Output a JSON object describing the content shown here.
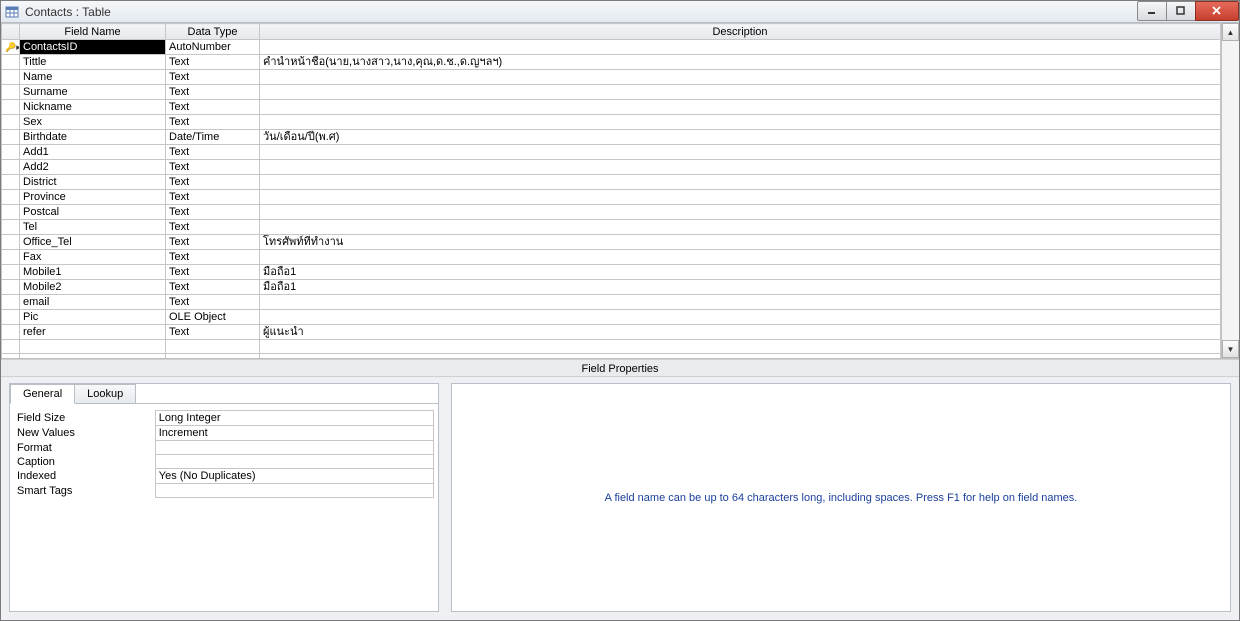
{
  "window": {
    "title": "Contacts : Table"
  },
  "grid": {
    "headers": {
      "field_name": "Field Name",
      "data_type": "Data Type",
      "description": "Description"
    },
    "rows": [
      {
        "pk": true,
        "field": "ContactsID",
        "type": "AutoNumber",
        "desc": ""
      },
      {
        "pk": false,
        "field": "Tittle",
        "type": "Text",
        "desc": "คำนำหน้าชื่อ(นาย,นางสาว,นาง,คุณ,ด.ช.,ด.ญฯลฯ)"
      },
      {
        "pk": false,
        "field": "Name",
        "type": "Text",
        "desc": ""
      },
      {
        "pk": false,
        "field": "Surname",
        "type": "Text",
        "desc": ""
      },
      {
        "pk": false,
        "field": "Nickname",
        "type": "Text",
        "desc": ""
      },
      {
        "pk": false,
        "field": "Sex",
        "type": "Text",
        "desc": ""
      },
      {
        "pk": false,
        "field": "Birthdate",
        "type": "Date/Time",
        "desc": "วัน/เดือน/ปี(พ.ศ)"
      },
      {
        "pk": false,
        "field": "Add1",
        "type": "Text",
        "desc": ""
      },
      {
        "pk": false,
        "field": "Add2",
        "type": "Text",
        "desc": ""
      },
      {
        "pk": false,
        "field": "District",
        "type": "Text",
        "desc": ""
      },
      {
        "pk": false,
        "field": "Province",
        "type": "Text",
        "desc": ""
      },
      {
        "pk": false,
        "field": "Postcal",
        "type": "Text",
        "desc": ""
      },
      {
        "pk": false,
        "field": "Tel",
        "type": "Text",
        "desc": ""
      },
      {
        "pk": false,
        "field": "Office_Tel",
        "type": "Text",
        "desc": "โทรศัพท์ที่ทำงาน"
      },
      {
        "pk": false,
        "field": "Fax",
        "type": "Text",
        "desc": ""
      },
      {
        "pk": false,
        "field": "Mobile1",
        "type": "Text",
        "desc": "มือถือ1"
      },
      {
        "pk": false,
        "field": "Mobile2",
        "type": "Text",
        "desc": "มือถือ1"
      },
      {
        "pk": false,
        "field": "email",
        "type": "Text",
        "desc": ""
      },
      {
        "pk": false,
        "field": "Pic",
        "type": "OLE Object",
        "desc": ""
      },
      {
        "pk": false,
        "field": "refer",
        "type": "Text",
        "desc": "ผู้แนะนำ"
      },
      {
        "pk": false,
        "field": "",
        "type": "",
        "desc": ""
      },
      {
        "pk": false,
        "field": "",
        "type": "",
        "desc": ""
      }
    ],
    "selected_row": 0
  },
  "field_properties": {
    "section_label": "Field Properties",
    "tabs": {
      "general": "General",
      "lookup": "Lookup"
    },
    "rows": [
      {
        "label": "Field Size",
        "value": "Long Integer"
      },
      {
        "label": "New Values",
        "value": "Increment"
      },
      {
        "label": "Format",
        "value": ""
      },
      {
        "label": "Caption",
        "value": ""
      },
      {
        "label": "Indexed",
        "value": "Yes (No Duplicates)"
      },
      {
        "label": "Smart Tags",
        "value": ""
      }
    ],
    "help_text": "A field name can be up to 64 characters long, including spaces.  Press F1 for help on field names."
  }
}
